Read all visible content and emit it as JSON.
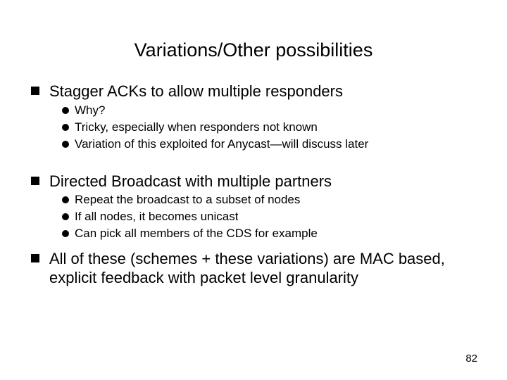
{
  "title": "Variations/Other possibilities",
  "bullets": [
    {
      "text": "Stagger ACKs to allow multiple responders",
      "subs": [
        "Why?",
        "Tricky, especially when responders not known",
        "Variation of this exploited for Anycast—will discuss later"
      ]
    },
    {
      "text": "Directed Broadcast with multiple partners",
      "subs": [
        "Repeat the broadcast to a subset of nodes",
        "If all nodes, it becomes unicast",
        "Can pick all members of the CDS for example"
      ]
    },
    {
      "text": "All of these (schemes + these variations) are MAC based, explicit feedback with packet level granularity",
      "subs": []
    }
  ],
  "page_number": "82"
}
